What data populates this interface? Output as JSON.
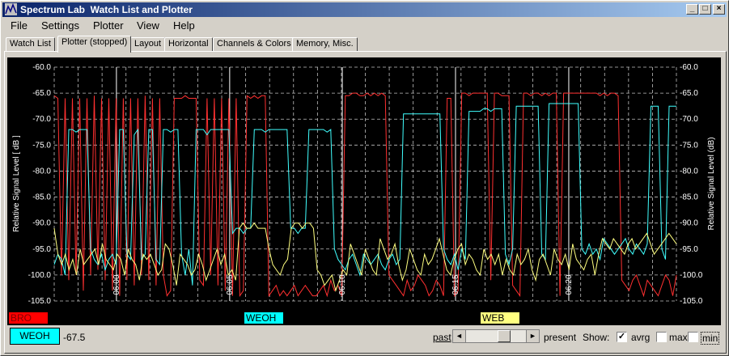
{
  "window": {
    "title": "Spectrum Lab  Watch List and Plotter"
  },
  "titlebar_buttons": {
    "minimize": "_",
    "maximize": "□",
    "close": "×"
  },
  "menu": [
    "File",
    "Settings",
    "Plotter",
    "View",
    "Help"
  ],
  "tabs": [
    "Watch List",
    "Plotter (stopped)",
    "Layout",
    "Horizontal",
    "Channels & Colors",
    "Memory, Misc."
  ],
  "active_tab": 1,
  "plot": {
    "y_axis_left_label": "Relative Signal Level [ dB ]",
    "y_axis_right_label": "Relative Signal Level (dB)",
    "y_ticks": [
      "-60.0",
      "-65.0",
      "-70.0",
      "-75.0",
      "-80.0",
      "-85.0",
      "-90.0",
      "-95.0",
      "-100.0",
      "-105.0"
    ],
    "time_labels": [
      "06:00",
      "06:05",
      "06:10",
      "06:15",
      "06:20"
    ],
    "channel_labels": [
      {
        "name": "BRO",
        "color": "#ff0000"
      },
      {
        "name": "WEOH",
        "color": "#00ffff"
      },
      {
        "name": "WEB",
        "color": "#ffff80"
      }
    ]
  },
  "bottom": {
    "channel_button": "WEOH",
    "value": "-67.5",
    "past_label": "past",
    "present_label": "present",
    "show_label": "Show:",
    "avrg_label": "avrg",
    "avrg_checked": true,
    "max_label": "max",
    "max_checked": false,
    "min_label": "min",
    "min_checked": false,
    "scroll_left": "◄",
    "scroll_right": "►"
  },
  "chart_data": {
    "type": "line",
    "ylim": [
      -105,
      -60
    ],
    "series": [
      {
        "name": "BRO",
        "color": "#ff3030",
        "values": [
          -65.5,
          -66,
          -100,
          -66,
          -101,
          -66,
          -100,
          -66,
          -103,
          -66,
          -100,
          -65.5,
          -99,
          -66,
          -101,
          -66,
          -103,
          -66,
          -104,
          -66,
          -101,
          -66,
          -102,
          -66,
          -100,
          -65.5,
          -101,
          -66,
          -102,
          -66,
          -100,
          -104,
          -103,
          -66,
          -66,
          -66,
          -65.5,
          -66,
          -66,
          -66,
          -101,
          -102,
          -66,
          -100,
          -66,
          -102,
          -66,
          -103,
          -66,
          -104,
          -66,
          -104,
          -103,
          -65.5,
          -66,
          -65.5,
          -66,
          -65.5,
          -65.5,
          -104,
          -103,
          -102,
          -104,
          -103,
          -104,
          -103,
          -102,
          -104,
          -103,
          -102,
          -103,
          -104,
          -104,
          -103,
          -102,
          -104,
          -101,
          -103,
          -102,
          -104,
          -65.5,
          -65.5,
          -65,
          -65,
          -65.5,
          -65.5,
          -65,
          -65.5,
          -65,
          -65.5,
          -65,
          -65.5,
          -100,
          -101,
          -102,
          -103,
          -104,
          -101,
          -103,
          -102,
          -100,
          -101,
          -102,
          -104,
          -103,
          -101,
          -102,
          -104,
          -66,
          -66,
          -104,
          -103,
          -65,
          -65,
          -65.5,
          -65,
          -65,
          -65,
          -65,
          -65,
          -101,
          -65,
          -65,
          -65.5,
          -65.5,
          -65.5,
          -102,
          -103,
          -104,
          -65,
          -65,
          -65.5,
          -65,
          -65,
          -65.5,
          -65,
          -65.5,
          -65,
          -65,
          -104,
          -65,
          -65,
          -65,
          -65,
          -65,
          -65,
          -65,
          -65,
          -65,
          -65,
          -65.5,
          -65,
          -65.5,
          -65,
          -65,
          -65.5,
          -101,
          -102,
          -103,
          -101,
          -100,
          -102,
          -104,
          -101,
          -102,
          -103,
          -104,
          -102,
          -100,
          -101,
          -104,
          -100
        ]
      },
      {
        "name": "WEOH",
        "color": "#40ffff",
        "values": [
          -98,
          -96,
          -97,
          -100,
          -72,
          -72,
          -72.5,
          -72,
          -72,
          -72,
          -95,
          -97,
          -98,
          -96,
          -99,
          -97,
          -96,
          -98,
          -72,
          -72,
          -96,
          -97,
          -73,
          -72,
          -97,
          -96,
          -72,
          -72,
          -97,
          -98,
          -72,
          -72,
          -72.5,
          -72,
          -72,
          -96,
          -100,
          -95,
          -102,
          -72,
          -72,
          -72,
          -73,
          -72,
          -72,
          -72,
          -72,
          -72,
          -72,
          -92,
          -91,
          -91,
          -92,
          -91,
          -91,
          -72,
          -72,
          -72,
          -72.5,
          -72,
          -72,
          -72,
          -72,
          -72,
          -72,
          -91,
          -91,
          -92,
          -91,
          -91,
          -72,
          -72,
          -72,
          -72,
          -72,
          -72.5,
          -72,
          -95,
          -97,
          -98,
          -99,
          -97,
          -96,
          -98,
          -100,
          -96,
          -97,
          -98,
          -97,
          -96,
          -98,
          -99,
          -97,
          -96,
          -98,
          -97,
          -69,
          -69,
          -69,
          -69,
          -69,
          -69,
          -69,
          -69,
          -69,
          -69,
          -69,
          -95,
          -97,
          -98,
          -96,
          -99,
          -95,
          -97,
          -68.5,
          -68.5,
          -68.5,
          -68.5,
          -68,
          -68,
          -68.5,
          -68,
          -68,
          -68,
          -96,
          -98,
          -95,
          -67.5,
          -67.5,
          -67.5,
          -67.5,
          -67.5,
          -67.5,
          -67.5,
          -96,
          -97,
          -67,
          -67,
          -67,
          -67,
          -67,
          -67,
          -67,
          -67,
          -67,
          -95,
          -96,
          -94,
          -96,
          -95,
          -97,
          -93,
          -94,
          -95,
          -96,
          -95,
          -94,
          -93,
          -95,
          -96,
          -94,
          -95,
          -96,
          -94,
          -67.5,
          -67.5,
          -67.5,
          -95,
          -97,
          -67.5,
          -67.5,
          -67.5
        ]
      },
      {
        "name": "WEB",
        "color": "#ffff80",
        "values": [
          -91,
          -96,
          -98,
          -96,
          -99,
          -97,
          -100,
          -95,
          -98,
          -97,
          -96,
          -95,
          -98,
          -94,
          -97,
          -98,
          -99,
          -96,
          -97,
          -100,
          -95,
          -97,
          -98,
          -101,
          -96,
          -97,
          -96,
          -98,
          -100,
          -99,
          -94,
          -95,
          -98,
          -102,
          -96,
          -97,
          -98,
          -100,
          -99,
          -96,
          -98,
          -101,
          -99,
          -97,
          -95,
          -98,
          -96,
          -100,
          -99,
          -101,
          -91,
          -90,
          -91,
          -91,
          -90,
          -91,
          -91,
          -91,
          -95,
          -98,
          -99,
          -100,
          -98,
          -97,
          -91,
          -90,
          -90,
          -91,
          -90,
          -90,
          -91,
          -99,
          -100,
          -102,
          -101,
          -100,
          -103,
          -101,
          -99,
          -100,
          -94,
          -96,
          -98,
          -100,
          -95,
          -97,
          -99,
          -100,
          -93,
          -95,
          -97,
          -96,
          -94,
          -98,
          -101,
          -99,
          -95,
          -97,
          -99,
          -100,
          -96,
          -98,
          -97,
          -95,
          -93,
          -96,
          -99,
          -100,
          -97,
          -95,
          -94,
          -98,
          -96,
          -97,
          -99,
          -100,
          -95,
          -97,
          -96,
          -98,
          -96,
          -100,
          -97,
          -99,
          -100,
          -96,
          -98,
          -97,
          -95,
          -99,
          -101,
          -97,
          -96,
          -98,
          -100,
          -95,
          -97,
          -98,
          -96,
          -99,
          -94,
          -97,
          -98,
          -99,
          -97,
          -96,
          -100,
          -96,
          -93,
          -94,
          -95,
          -93,
          -94,
          -95,
          -96,
          -94,
          -93,
          -95,
          -94,
          -93,
          -92,
          -94,
          -96,
          -95,
          -94,
          -93,
          -92,
          -93,
          -94
        ]
      }
    ]
  }
}
